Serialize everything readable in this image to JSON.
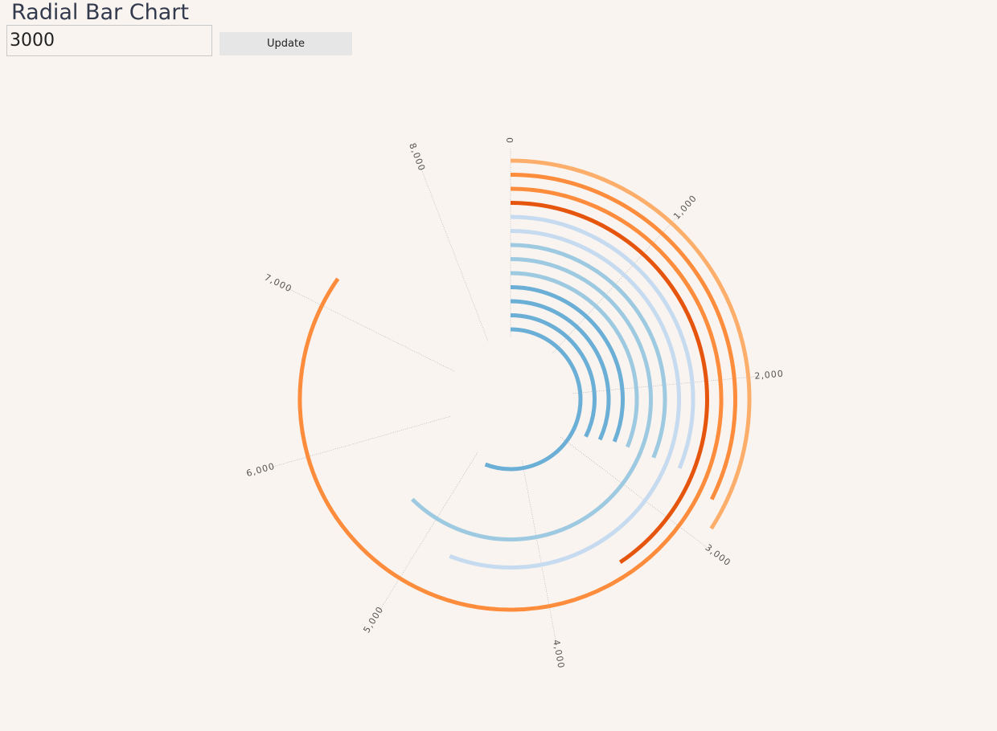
{
  "header": {
    "title": "Radial Bar Chart"
  },
  "controls": {
    "input_value": "3000",
    "update_label": "Update"
  },
  "chart_data": {
    "type": "radial-bar",
    "max_value": 8500,
    "ticks": [
      {
        "value": 0,
        "label": "0"
      },
      {
        "value": 1000,
        "label": "1,000"
      },
      {
        "value": 2000,
        "label": "2,000"
      },
      {
        "value": 3000,
        "label": "3,000"
      },
      {
        "value": 4000,
        "label": "4,000"
      },
      {
        "value": 5000,
        "label": "5,000"
      },
      {
        "value": 6000,
        "label": "6,000"
      },
      {
        "value": 7000,
        "label": "7,000"
      },
      {
        "value": 8000,
        "label": "8,000"
      }
    ],
    "highlight_threshold": 3000,
    "bars": [
      {
        "value": 2900,
        "color": "#fdae6b"
      },
      {
        "value": 2750,
        "color": "#fd8d3c"
      },
      {
        "value": 7200,
        "color": "#fd8d3c"
      },
      {
        "value": 3450,
        "color": "#e6550d"
      },
      {
        "value": 2650,
        "color": "#c6dbef"
      },
      {
        "value": 4750,
        "color": "#c6dbef"
      },
      {
        "value": 2650,
        "color": "#9ecae1"
      },
      {
        "value": 5300,
        "color": "#9ecae1"
      },
      {
        "value": 2650,
        "color": "#9ecae1"
      },
      {
        "value": 2650,
        "color": "#6baed6"
      },
      {
        "value": 2700,
        "color": "#6baed6"
      },
      {
        "value": 2750,
        "color": "#6baed6"
      },
      {
        "value": 4750,
        "color": "#6baed6"
      }
    ]
  }
}
